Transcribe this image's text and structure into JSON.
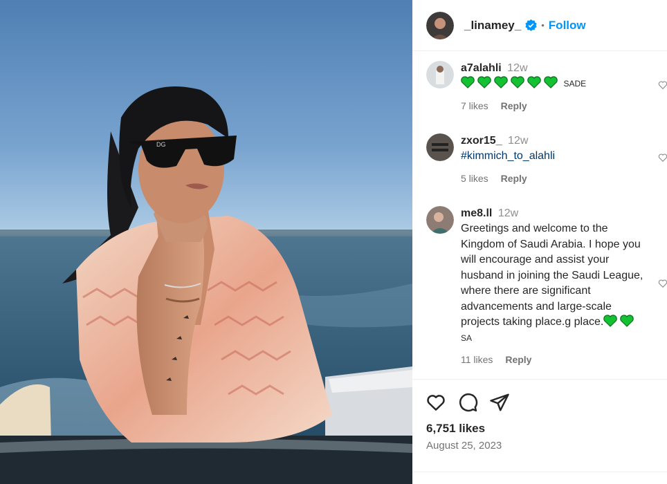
{
  "post": {
    "username": "_linamey_",
    "follow_label": "Follow",
    "separator": "•",
    "likes": "6,751 likes",
    "date": "August 25, 2023"
  },
  "comments": [
    {
      "username": "a7alahli",
      "time": "12w",
      "text": "SADE",
      "hearts": 6,
      "likes": "7 likes",
      "reply": "Reply"
    },
    {
      "username": "zxor15_",
      "time": "12w",
      "text": "#kimmich_to_alahli",
      "likes": "5 likes",
      "reply": "Reply"
    },
    {
      "username": "me8.ll",
      "time": "12w",
      "text": "Greetings and welcome to the Kingdom of Saudi Arabia. I hope you will encourage and assist your husband in joining the Saudi League, where there are significant advancements and large-scale projects taking place.g place.",
      "hearts": 2,
      "suffix": "SA",
      "likes": "11 likes",
      "reply": "Reply"
    }
  ],
  "colors": {
    "accent": "#0095f6",
    "heart": "#13c132",
    "text": "#262626",
    "muted": "#737373",
    "hashtag": "#00376b"
  },
  "icons": [
    "verified-badge-icon",
    "heart-icon",
    "comment-icon",
    "share-icon",
    "green-heart-icon",
    "small-heart-icon"
  ]
}
